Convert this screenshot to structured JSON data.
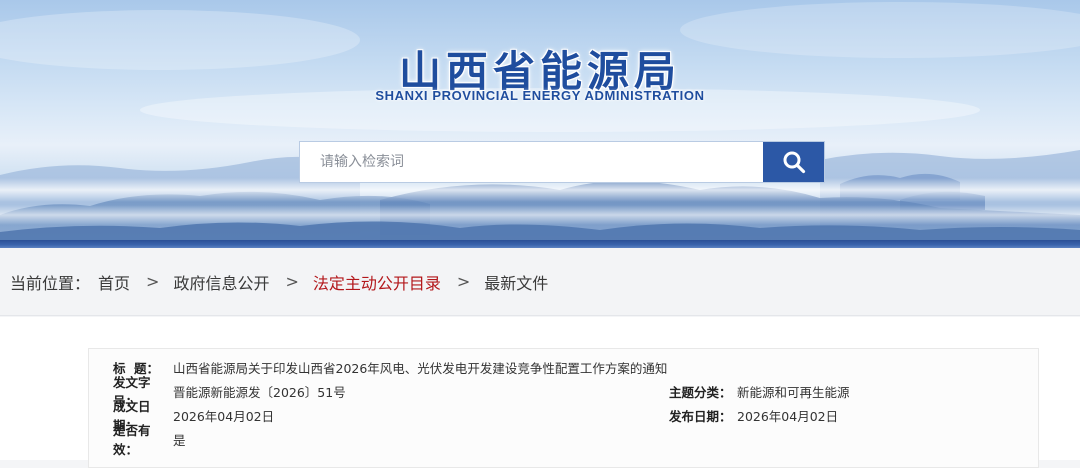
{
  "header": {
    "site_name_cn": "山西省能源局",
    "site_name_en": "SHANXI PROVINCIAL ENERGY ADMINISTRATION"
  },
  "search": {
    "placeholder": "请输入检索词",
    "value": "",
    "button_icon": "search-icon"
  },
  "breadcrumb": {
    "label": "当前位置：",
    "items": [
      {
        "label": "首页",
        "active": false
      },
      {
        "label": "政府信息公开",
        "active": false
      },
      {
        "label": "法定主动公开目录",
        "active": true
      },
      {
        "label": "最新文件",
        "active": false
      }
    ],
    "separator": ">"
  },
  "document": {
    "title_key_1": "标",
    "title_key_2": "题：",
    "title": "山西省能源局关于印发山西省2026年风电、光伏发电开发建设竞争性配置工作方案的通知",
    "doc_no_key": "发文字号：",
    "doc_no": "晋能源新能源发〔2026〕51号",
    "topic_key": "主题分类：",
    "topic": "新能源和可再生能源",
    "created_key": "成文日期：",
    "created": "2026年04月02日",
    "published_key": "发布日期：",
    "published": "2026年04月02日",
    "valid_key": "是否有效：",
    "valid": "是"
  },
  "colors": {
    "brand_blue": "#1f4d9e",
    "search_button": "#2c58a6",
    "active_crumb": "#b3171b"
  }
}
